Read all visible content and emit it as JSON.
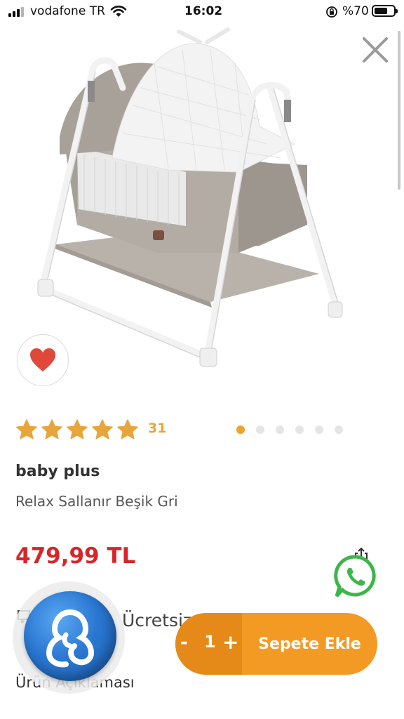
{
  "status_bar": {
    "carrier": "vodafone TR",
    "time": "16:02",
    "battery_percent": "%70",
    "battery_level": 0.7,
    "signal_bars_active": 3
  },
  "icons": {
    "close": "close-icon",
    "favorite": "heart-icon",
    "share": "share-icon",
    "whatsapp": "whatsapp-icon",
    "star": "star-icon"
  },
  "product": {
    "rating_value": 5,
    "rating_count": "31",
    "brand": "baby plus",
    "name": "Relax Sallanır Beşik Gri",
    "price": "479,99 TL",
    "gallery_total": 6,
    "gallery_active": 0
  },
  "shipping": {
    "label": "Ücretsiz Kargo"
  },
  "description_link": "Ürün Açıklaması",
  "cart": {
    "minus_label": "-",
    "quantity": "1",
    "plus_label": "+",
    "add_label": "Sepete Ekle"
  },
  "colors": {
    "accent": "#f39a25",
    "accent_dark": "#e58918",
    "price": "#d9252a",
    "star": "#e7a53a",
    "heart": "#e0483b",
    "whatsapp": "#3db54a"
  }
}
